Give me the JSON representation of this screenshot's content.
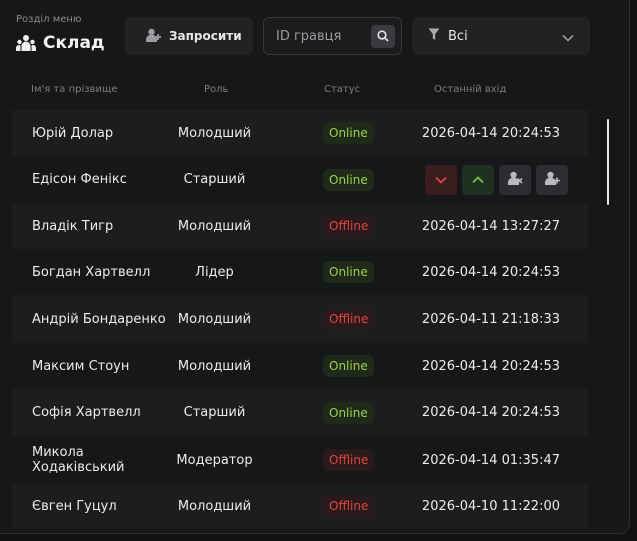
{
  "header": {
    "section_caption": "Розділ меню",
    "title": "Склад",
    "invite_label": "Запросити",
    "search_placeholder": "ID гравця",
    "filter_value": "Всі"
  },
  "columns": {
    "name": "Ім'я та прізвище",
    "role": "Роль",
    "status": "Статус",
    "last_login": "Останній вхід"
  },
  "rows": [
    {
      "name": "Юрій Долар",
      "role": "Молодший",
      "status": "Online",
      "last_login": "2026-04-14 20:24:53"
    },
    {
      "name": "Едісон Фенікс",
      "role": "Старший",
      "status": "Online",
      "last_login": ""
    },
    {
      "name": "Владік Тигр",
      "role": "Молодший",
      "status": "Offline",
      "last_login": "2026-04-14 13:27:27"
    },
    {
      "name": "Богдан Хартвелл",
      "role": "Лідер",
      "status": "Online",
      "last_login": "2026-04-14 20:24:53"
    },
    {
      "name": "Андрій Бондаренко",
      "role": "Молодший",
      "status": "Offline",
      "last_login": "2026-04-11 21:18:33"
    },
    {
      "name": "Максим Стоун",
      "role": "Молодший",
      "status": "Online",
      "last_login": "2026-04-14 20:24:53"
    },
    {
      "name": "Софія Хартвелл",
      "role": "Старший",
      "status": "Online",
      "last_login": "2026-04-14 20:24:53"
    },
    {
      "name": "Микола Ходаківський",
      "role": "Модератор",
      "status": "Offline",
      "last_login": "2026-04-14 01:35:47"
    },
    {
      "name": "Євген Гуцул",
      "role": "Молодший",
      "status": "Offline",
      "last_login": "2026-04-10 11:22:00"
    }
  ],
  "colors": {
    "online": "#9bd04a",
    "offline": "#e0463e",
    "background": "#161718"
  }
}
